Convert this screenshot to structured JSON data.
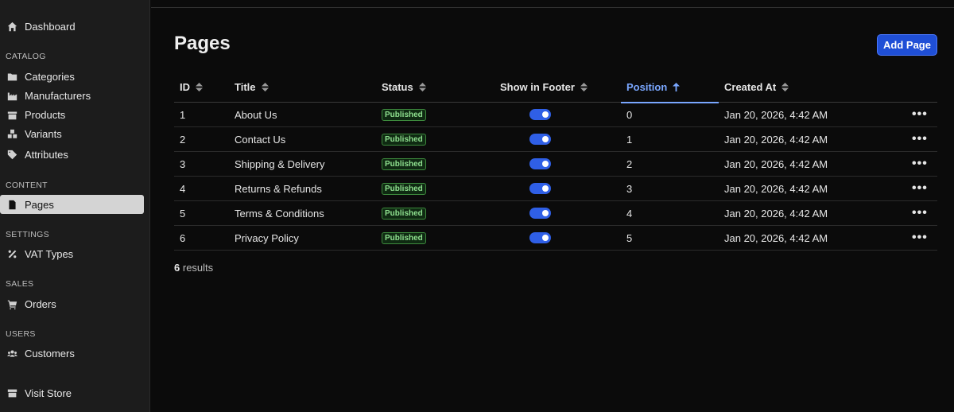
{
  "sidebar": {
    "dashboard": "Dashboard",
    "sections": {
      "catalog": "CATALOG",
      "content": "CONTENT",
      "settings": "SETTINGS",
      "sales": "SALES",
      "users": "USERS"
    },
    "items": {
      "categories": "Categories",
      "manufacturers": "Manufacturers",
      "products": "Products",
      "variants": "Variants",
      "attributes": "Attributes",
      "pages": "Pages",
      "vat_types": "VAT Types",
      "orders": "Orders",
      "customers": "Customers",
      "visit_store": "Visit Store"
    }
  },
  "main": {
    "title": "Pages",
    "add_button": "Add Page",
    "columns": {
      "id": "ID",
      "title": "Title",
      "status": "Status",
      "footer": "Show in Footer",
      "position": "Position",
      "created": "Created At"
    },
    "sorted_column": "Position",
    "rows": [
      {
        "id": "1",
        "title": "About Us",
        "status": "Published",
        "footer": true,
        "position": "0",
        "created": "Jan 20, 2026, 4:42 AM"
      },
      {
        "id": "2",
        "title": "Contact Us",
        "status": "Published",
        "footer": true,
        "position": "1",
        "created": "Jan 20, 2026, 4:42 AM"
      },
      {
        "id": "3",
        "title": "Shipping & Delivery",
        "status": "Published",
        "footer": true,
        "position": "2",
        "created": "Jan 20, 2026, 4:42 AM"
      },
      {
        "id": "4",
        "title": "Returns & Refunds",
        "status": "Published",
        "footer": true,
        "position": "3",
        "created": "Jan 20, 2026, 4:42 AM"
      },
      {
        "id": "5",
        "title": "Terms & Conditions",
        "status": "Published",
        "footer": true,
        "position": "4",
        "created": "Jan 20, 2026, 4:42 AM"
      },
      {
        "id": "6",
        "title": "Privacy Policy",
        "status": "Published",
        "footer": true,
        "position": "5",
        "created": "Jan 20, 2026, 4:42 AM"
      }
    ],
    "results_count": "6",
    "results_label": "results"
  },
  "colors": {
    "accent": "#1f4fd6",
    "sort_active": "#7aa7ff",
    "badge_text": "#8fe08f",
    "toggle_on": "#2f5fe6"
  },
  "icons": {
    "dashboard": "home-icon",
    "categories": "folder-icon",
    "manufacturers": "factory-icon",
    "products": "box-icon",
    "variants": "cubes-icon",
    "attributes": "tag-icon",
    "pages": "file-icon",
    "vat_types": "percent-icon",
    "orders": "cart-icon",
    "customers": "users-icon",
    "visit_store": "store-icon"
  }
}
